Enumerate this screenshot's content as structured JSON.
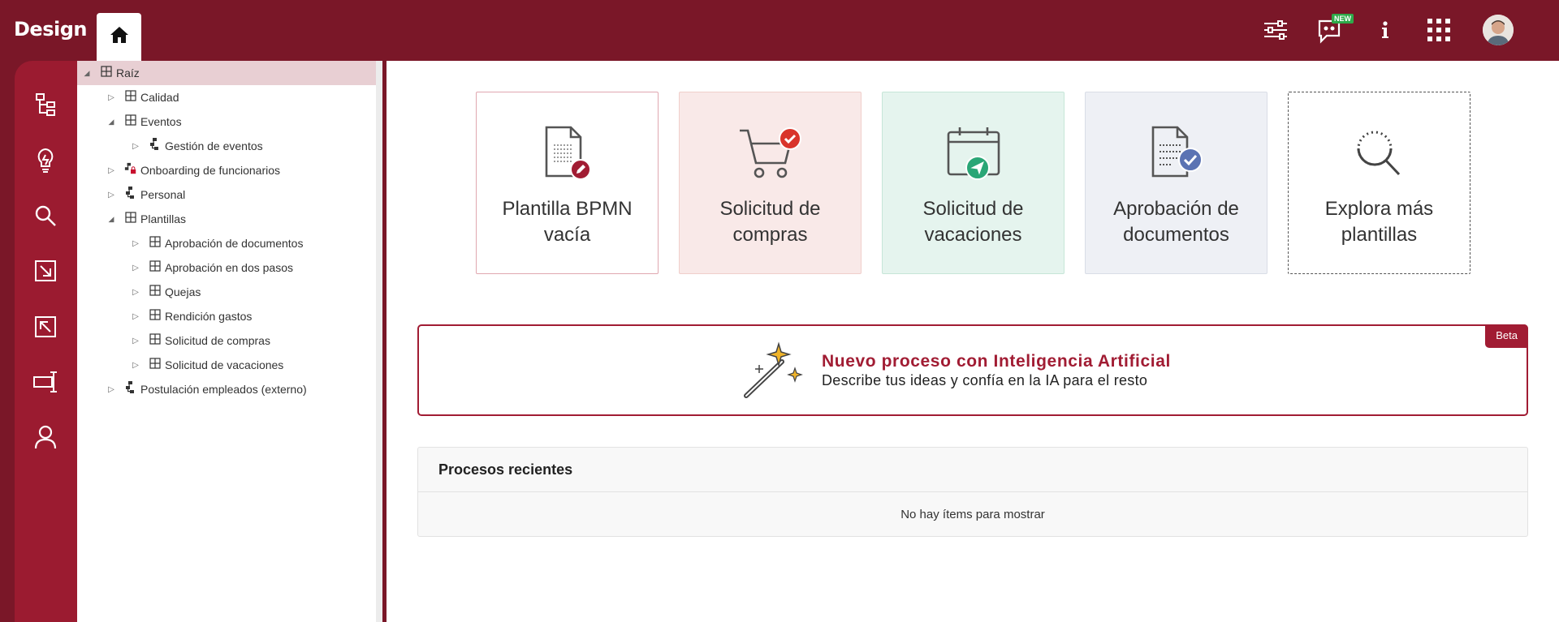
{
  "app": {
    "brand": "Design"
  },
  "topbar": {
    "icons": [
      {
        "name": "filters-icon"
      },
      {
        "name": "feedback-chat-icon",
        "badge": "NEW"
      },
      {
        "name": "info-icon"
      },
      {
        "name": "apps-grid-icon"
      },
      {
        "name": "user-avatar"
      }
    ]
  },
  "sidebar": {
    "items": [
      {
        "name": "process-tree-icon"
      },
      {
        "name": "ideas-bulb-icon"
      },
      {
        "name": "search-icon"
      },
      {
        "name": "import-icon"
      },
      {
        "name": "export-icon"
      },
      {
        "name": "deploy-icon"
      },
      {
        "name": "user-icon"
      }
    ]
  },
  "tree": {
    "nodes": [
      {
        "label": "Raíz",
        "type": "folder",
        "level": 0,
        "expanded": true,
        "selected": true
      },
      {
        "label": "Calidad",
        "type": "folder",
        "level": 1,
        "expanded": false
      },
      {
        "label": "Eventos",
        "type": "folder",
        "level": 1,
        "expanded": true
      },
      {
        "label": "Gestión de eventos",
        "type": "process",
        "level": 2,
        "expanded": false
      },
      {
        "label": "Onboarding de funcionarios",
        "type": "process-locked",
        "level": 1,
        "expanded": false
      },
      {
        "label": "Personal",
        "type": "process",
        "level": 1,
        "expanded": false
      },
      {
        "label": "Plantillas",
        "type": "folder",
        "level": 1,
        "expanded": true
      },
      {
        "label": "Aprobación de documentos",
        "type": "folder",
        "level": 2,
        "expanded": false
      },
      {
        "label": "Aprobación en dos pasos",
        "type": "folder",
        "level": 2,
        "expanded": false
      },
      {
        "label": "Quejas",
        "type": "folder",
        "level": 2,
        "expanded": false
      },
      {
        "label": "Rendición gastos",
        "type": "folder",
        "level": 2,
        "expanded": false
      },
      {
        "label": "Solicitud de compras",
        "type": "folder",
        "level": 2,
        "expanded": false
      },
      {
        "label": "Solicitud de vacaciones",
        "type": "folder",
        "level": 2,
        "expanded": false
      },
      {
        "label": "Postulación empleados (externo)",
        "type": "process",
        "level": 1,
        "expanded": false
      }
    ]
  },
  "templates": [
    {
      "line1": "Plantilla BPMN",
      "line2": "vacía",
      "bg": "#ffffff",
      "border": "#e0a7b0",
      "icon": "blank-bpmn-icon",
      "accent": "#a11c33"
    },
    {
      "line1": "Solicitud de",
      "line2": "compras",
      "bg": "#f9e9e8",
      "border": "#f0cfcb",
      "icon": "shopping-cart-icon",
      "accent": "#d9342b"
    },
    {
      "line1": "Solicitud de",
      "line2": "vacaciones",
      "bg": "#e5f4ee",
      "border": "#c6e6d8",
      "icon": "calendar-send-icon",
      "accent": "#2aa676"
    },
    {
      "line1": "Aprobación de",
      "line2": "documentos",
      "bg": "#eef0f5",
      "border": "#d9dde6",
      "icon": "document-check-icon",
      "accent": "#5b73b3"
    },
    {
      "line1": "Explora más",
      "line2": "plantillas",
      "bg": "#ffffff",
      "border": "#555555",
      "icon": "explore-search-icon",
      "accent": "#333333"
    }
  ],
  "ai_banner": {
    "badge": "Beta",
    "title": "Nuevo proceso con Inteligencia Artificial",
    "subtitle": "Describe tus ideas y confía en la IA para el resto"
  },
  "recent": {
    "title": "Procesos recientes",
    "empty": "No hay ítems para mostrar"
  },
  "colors": {
    "brand_dark": "#7a1728",
    "brand": "#9b1b30",
    "accent": "#a11c33",
    "selected_row": "#e8cfd3"
  }
}
